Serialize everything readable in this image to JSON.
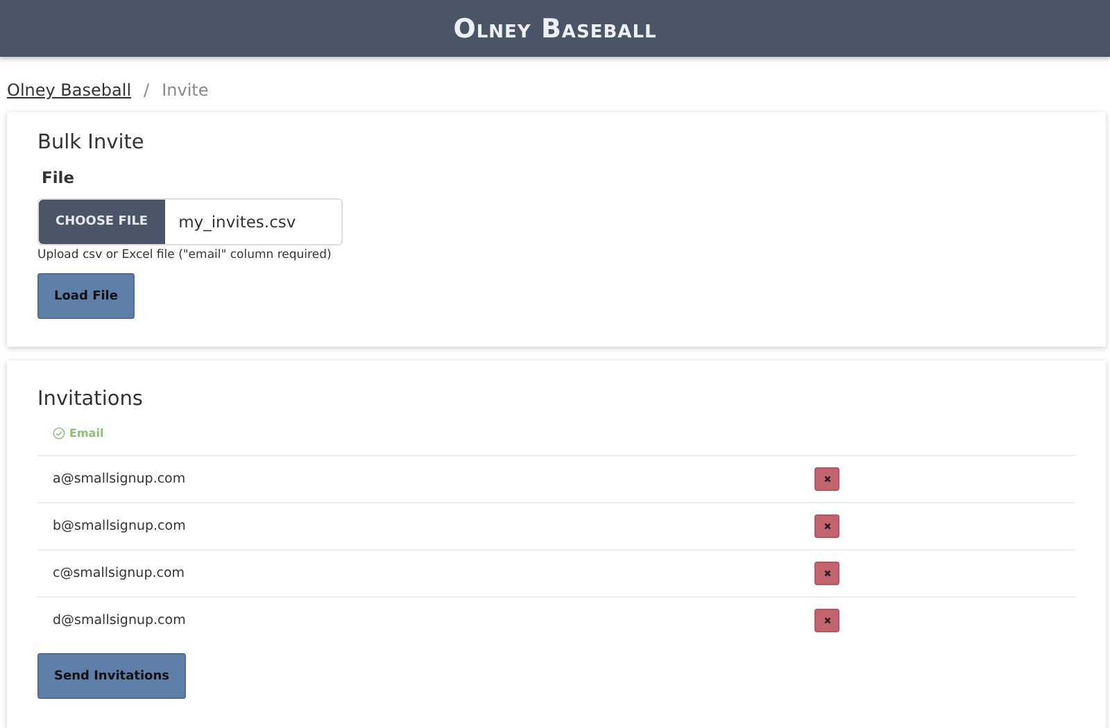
{
  "header": {
    "title": "Olney Baseball"
  },
  "breadcrumb": [
    {
      "label": "Olney Baseball",
      "kind": "link"
    },
    {
      "label": "/",
      "kind": "separator"
    },
    {
      "label": "Invite",
      "kind": "current"
    }
  ],
  "bulk_invite": {
    "title": "Bulk Invite",
    "file_label": "File",
    "choose_button": "CHOOSE FILE",
    "file_name": "my_invites.csv",
    "hint": "Upload csv or Excel file (\"email\" column required)",
    "load_button": "Load File"
  },
  "invitations": {
    "title": "Invitations",
    "column": "Email",
    "rows": [
      {
        "email": "a@smallsignup.com"
      },
      {
        "email": "b@smallsignup.com"
      },
      {
        "email": "c@smallsignup.com"
      },
      {
        "email": "d@smallsignup.com"
      }
    ],
    "send_button": "Send Invitations"
  }
}
